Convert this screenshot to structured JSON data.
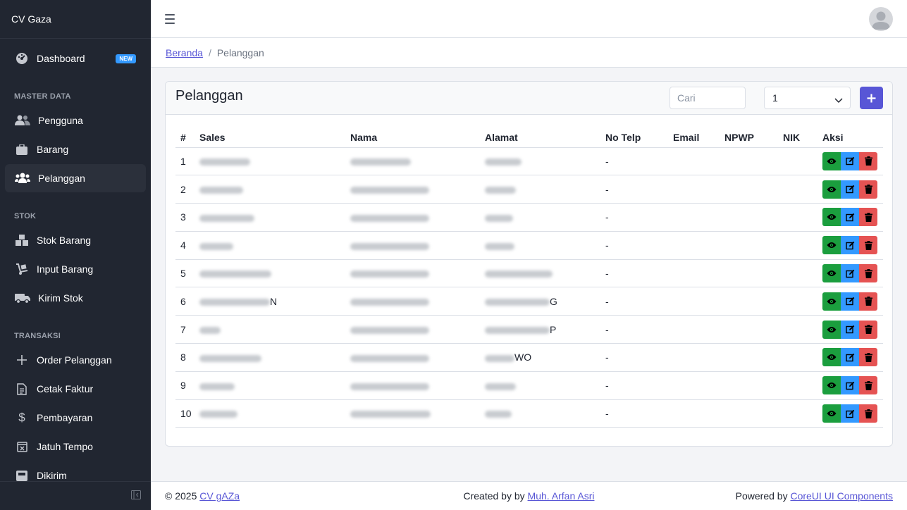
{
  "sidebar": {
    "brand": "CV Gaza",
    "dashboard": {
      "label": "Dashboard",
      "badge": "NEW"
    },
    "sections": {
      "master": "MASTER DATA",
      "stok": "STOK",
      "transaksi": "TRANSAKSI"
    },
    "items": {
      "pengguna": "Pengguna",
      "barang": "Barang",
      "pelanggan": "Pelanggan",
      "stok_barang": "Stok Barang",
      "input_barang": "Input Barang",
      "kirim_stok": "Kirim Stok",
      "order_pelanggan": "Order Pelanggan",
      "cetak_faktur": "Cetak Faktur",
      "pembayaran": "Pembayaran",
      "jatuh_tempo": "Jatuh Tempo",
      "dikirim": "Dikirim"
    }
  },
  "breadcrumb": {
    "home": "Beranda",
    "separator": "/",
    "current": "Pelanggan"
  },
  "card": {
    "title": "Pelanggan",
    "search_placeholder": "Cari",
    "page_select": "1",
    "add_label": "+"
  },
  "table": {
    "headers": [
      "#",
      "Sales",
      "Nama",
      "Alamat",
      "No Telp",
      "Email",
      "NPWP",
      "NIK",
      "Aksi"
    ],
    "rows": [
      {
        "no": "1",
        "sales": "",
        "nama": "",
        "alamat": "",
        "telp": "-"
      },
      {
        "no": "2",
        "sales": "",
        "nama": "",
        "alamat": "",
        "telp": "-"
      },
      {
        "no": "3",
        "sales": "",
        "nama": "",
        "alamat": "",
        "telp": "-"
      },
      {
        "no": "4",
        "sales": "",
        "nama": "",
        "alamat": "",
        "telp": "-"
      },
      {
        "no": "5",
        "sales": "",
        "nama": "",
        "alamat": "",
        "telp": "-"
      },
      {
        "no": "6",
        "sales": "N",
        "nama": "",
        "alamat": "G",
        "telp": "-"
      },
      {
        "no": "7",
        "sales": "",
        "nama": "",
        "alamat": "P",
        "telp": "-"
      },
      {
        "no": "8",
        "sales": "",
        "nama": "",
        "alamat": "WO",
        "telp": "-"
      },
      {
        "no": "9",
        "sales": "",
        "nama": "",
        "alamat": "",
        "telp": "-"
      },
      {
        "no": "10",
        "sales": "",
        "nama": "",
        "alamat": "",
        "telp": "-"
      }
    ]
  },
  "footer": {
    "copyright": "© 2025",
    "company_link": "CV gAZa",
    "created_prefix": "Created by by",
    "author_link": "Muh. Arfan Asri",
    "powered_prefix": "Powered by",
    "powered_link": "CoreUI UI Components"
  },
  "colors": {
    "sidebar": "#212631",
    "primary": "#5856d6",
    "view": "#1b9e3e",
    "edit": "#3399ff",
    "delete": "#e55353",
    "badge": "#3399ff"
  }
}
